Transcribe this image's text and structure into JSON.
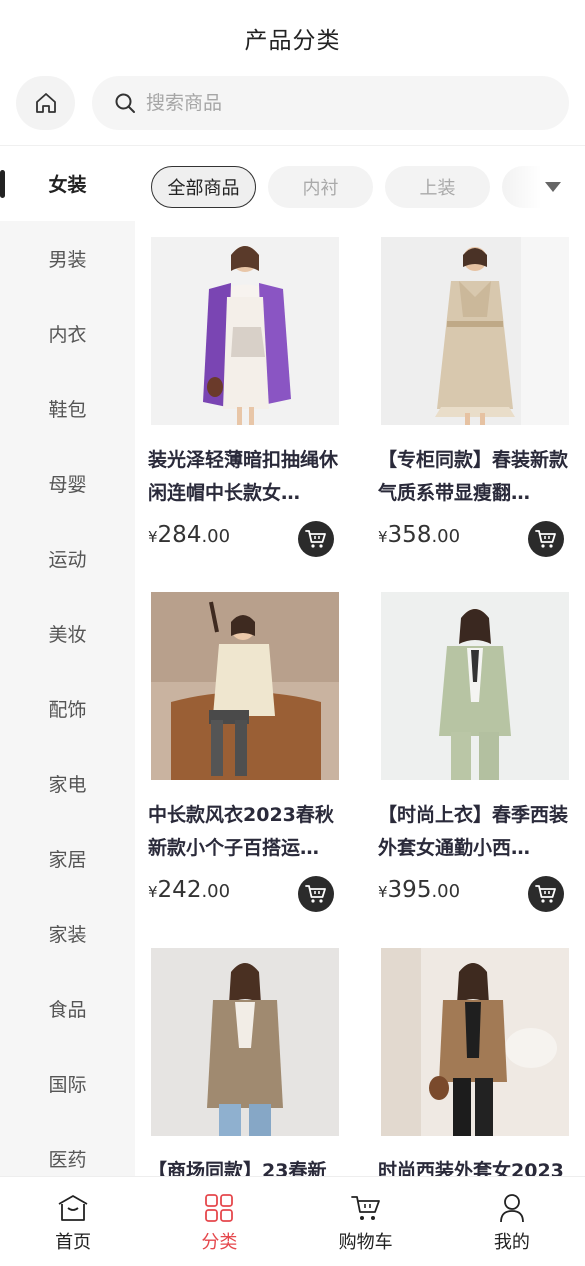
{
  "header": {
    "title": "产品分类"
  },
  "search": {
    "placeholder": "搜索商品",
    "home_icon": "home-icon",
    "search_icon": "search-icon"
  },
  "sidebar": {
    "items": [
      {
        "label": "女装",
        "active": true
      },
      {
        "label": "男装"
      },
      {
        "label": "内衣"
      },
      {
        "label": "鞋包"
      },
      {
        "label": "母婴"
      },
      {
        "label": "运动"
      },
      {
        "label": "美妆"
      },
      {
        "label": "配饰"
      },
      {
        "label": "家电"
      },
      {
        "label": "家居"
      },
      {
        "label": "家装"
      },
      {
        "label": "食品"
      },
      {
        "label": "国际"
      },
      {
        "label": "医药"
      }
    ]
  },
  "tabs": {
    "items": [
      {
        "label": "全部商品",
        "active": true
      },
      {
        "label": "内衬"
      },
      {
        "label": "上装"
      },
      {
        "label": ""
      }
    ],
    "more_icon": "caret-down-icon"
  },
  "products": [
    {
      "name": "装光泽轻薄暗扣抽绳休闲连帽中长款女…",
      "currency": "¥",
      "price_int": "284",
      "price_dec": ".00"
    },
    {
      "name": "【专柜同款】春装新款气质系带显瘦翻…",
      "currency": "¥",
      "price_int": "358",
      "price_dec": ".00"
    },
    {
      "name": "中长款风衣2023春秋新款小个子百搭运…",
      "currency": "¥",
      "price_int": "242",
      "price_dec": ".00"
    },
    {
      "name": "【时尚上衣】春季西装外套女通勤小西…",
      "currency": "¥",
      "price_int": "395",
      "price_dec": ".00"
    },
    {
      "name": "【商场同款】23春新",
      "currency": "¥",
      "price_int": "",
      "price_dec": ""
    },
    {
      "name": "时尚西装外套女2023",
      "currency": "¥",
      "price_int": "",
      "price_dec": ""
    }
  ],
  "bottom_nav": {
    "items": [
      {
        "label": "首页",
        "icon": "home-icon"
      },
      {
        "label": "分类",
        "icon": "category-icon",
        "active": true
      },
      {
        "label": "购物车",
        "icon": "cart-icon"
      },
      {
        "label": "我的",
        "icon": "user-icon"
      }
    ]
  },
  "colors": {
    "accent": "#e5484d",
    "dark": "#2b2b2b",
    "sidebar_bg": "#f6f6f6"
  }
}
